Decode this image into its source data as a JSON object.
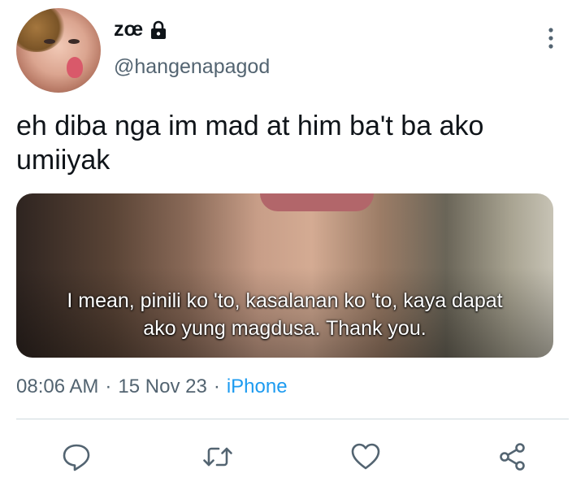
{
  "tweet": {
    "author": {
      "name": "zœ",
      "handle": "@hangenapagod",
      "protected_icon": "lock-icon",
      "avatar": "avatar-photo"
    },
    "text": "eh diba nga im mad at him ba't ba ako umiiyak",
    "media": {
      "caption_line1": "I mean, pinili ko 'to, kasalanan ko 'to, kaya dapat",
      "caption_line2": "ako yung magdusa. Thank you."
    },
    "meta": {
      "time": "08:06 AM",
      "separator1": "·",
      "date": "15 Nov 23",
      "separator2": "·",
      "source": "iPhone"
    },
    "actions": [
      {
        "name": "reply",
        "icon": "reply-icon"
      },
      {
        "name": "retweet",
        "icon": "retweet-icon"
      },
      {
        "name": "like",
        "icon": "heart-icon"
      },
      {
        "name": "share",
        "icon": "share-icon"
      }
    ],
    "colors": {
      "text": "#0f1419",
      "secondary": "#536471",
      "link": "#1d9bf0",
      "divider": "#cfd9de"
    }
  }
}
